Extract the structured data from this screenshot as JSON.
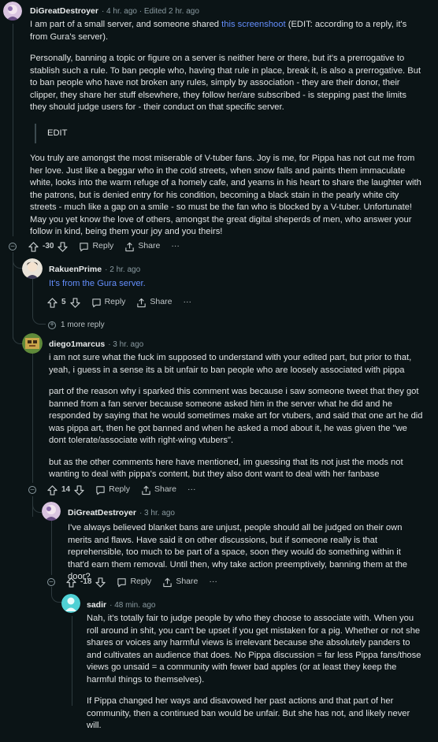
{
  "comments": {
    "c1": {
      "username": "DiGreatDestroyer",
      "meta": "· 4 hr. ago · Edited 2 hr. ago",
      "para1_pre": "I am part of a small server, and someone shared ",
      "para1_link": "this screenshoot",
      "para1_post": " (EDIT: according to a reply, it's from Gura's server).",
      "para2": "Personally, banning a topic or figure on a server is neither here or there, but it's a prerrogative to stablish such a rule. To ban people who, having that rule in place, break it, is also a prerrogative. But to ban people who have not broken any rules, simply by association - they are their donor, their clipper, they share her stuff elsewhere, they follow her/are subscribed - is stepping past the limits they should judge users for - their conduct on that specific server.",
      "quote": "EDIT",
      "para3": "You truly are amongst the most miserable of V-tuber fans. Joy is me, for Pippa has not cut me from her love. Just like a beggar who in the cold streets, when snow falls and paints them immaculate white, looks into the warm refuge of a homely cafe, and yearns in his heart to share the laughter with the patrons, but is denied entry for his condition, becoming a black stain in the pearly white city streets - much like a gap on a smile - so must be the fan who is blocked by a V-tuber. Unfortunate! May you yet know the love of others, amongst the great digital sheperds of men, who answer your follow in kind, being them your joy and you theirs!",
      "score": "-30",
      "reply_label": "Reply",
      "share_label": "Share",
      "more_label": "···"
    },
    "c2": {
      "username": "RakuenPrime",
      "meta": "· 2 hr. ago",
      "text": "It's from the Gura server.",
      "score": "5",
      "reply_label": "Reply",
      "share_label": "Share",
      "more_label": "···",
      "more_replies": "1 more reply"
    },
    "c3": {
      "username": "diego1marcus",
      "meta": "· 3 hr. ago",
      "para1": "i am not sure what the fuck im supposed to understand with your edited part, but prior to that, yeah, i guess in a sense its a bit unfair to ban people who are loosely associated with pippa",
      "para2": "part of the reason why i sparked this comment was because i saw someone tweet that they got banned from a fan server because someone asked him in the server what he did and he responded by saying that he would sometimes make art for vtubers, and said that one art he did was pippa art, then he got banned and when he asked a mod about it, he was given the \"we dont tolerate/associate with right-wing vtubers\".",
      "para3": "but as the other comments here have mentioned, im guessing that its not just the mods not wanting to deal with pippa's content, but they also dont want to deal with her fanbase",
      "score": "14",
      "reply_label": "Reply",
      "share_label": "Share",
      "more_label": "···"
    },
    "c4": {
      "username": "DiGreatDestroyer",
      "meta": "· 3 hr. ago",
      "text": "I've always believed blanket bans are unjust, people should all be judged on their own merits and flaws. Have said it on other discussions, but if someone really is that reprehensible, too much to be part of a space, soon they would do something within it that'd earn them removal. Until then, why take action preemptively, banning them at the door?",
      "score": "-18",
      "reply_label": "Reply",
      "share_label": "Share",
      "more_label": "···"
    },
    "c5": {
      "username": "sadir",
      "meta": "· 48 min. ago",
      "para1": "Nah, it's totally fair to judge people by who they choose to associate with. When you roll around in shit, you can't be upset if you get mistaken for a pig. Whether or not she shares or voices any harmful views is irrelevant because she absolutely panders to and cultivates an audience that does. No Pippa discussion = far less Pippa fans/those views go unsaid = a community with fewer bad apples (or at least they keep the harmful things to themselves).",
      "para2": "If Pippa changed her ways and disavowed her past actions and that part of her community, then a continued ban would be unfair. But she has not, and likely never will."
    }
  },
  "icons": {
    "upvote": "arrow-up-icon",
    "downvote": "arrow-down-icon",
    "reply": "speech-bubble-icon",
    "share": "share-icon",
    "collapse": "minus-circle-icon",
    "expand": "plus-circle-icon"
  },
  "colors": {
    "background": "#0b1416",
    "link": "#648efc",
    "text": "#d7dadc",
    "meta": "#8a9aa0"
  }
}
